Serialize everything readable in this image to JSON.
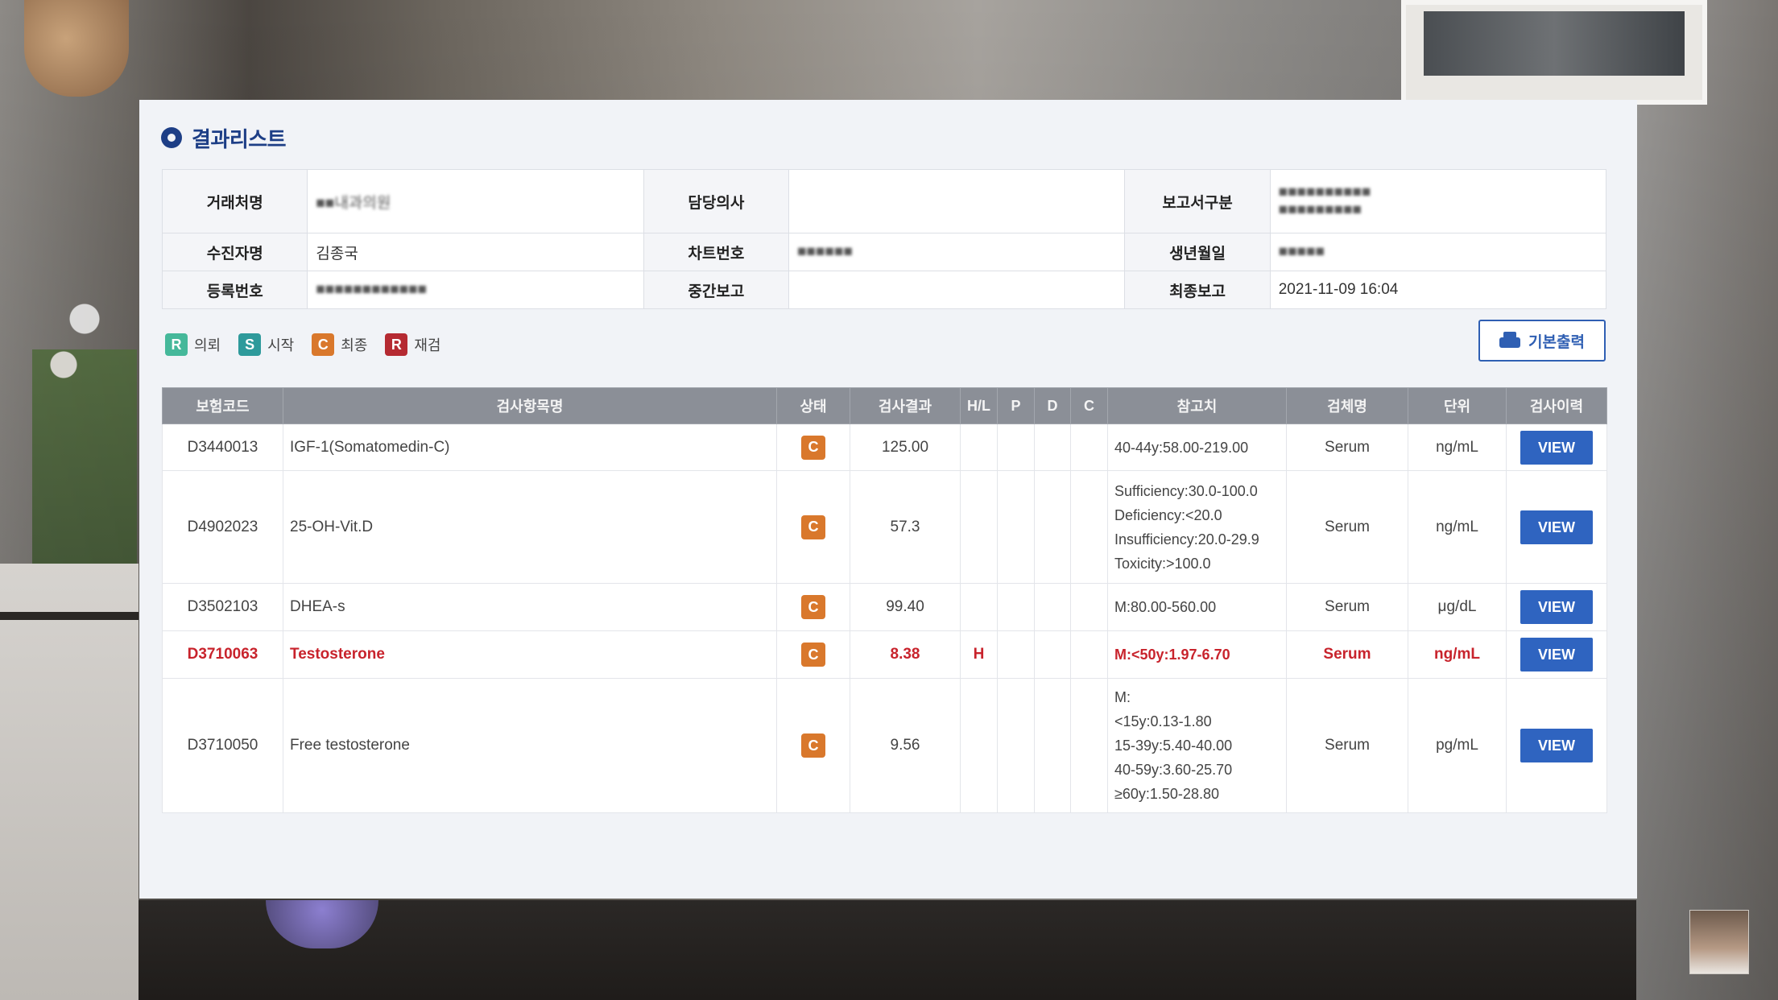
{
  "panel": {
    "title": "결과리스트"
  },
  "info": {
    "row1": {
      "client_label": "거래처명",
      "client_value": "■■내과의원",
      "doctor_label": "담당의사",
      "doctor_value": "",
      "report_type_label": "보고서구분",
      "report_type_value_1": "■■■■■■■■■■",
      "report_type_value_2": "■■■■■■■■■"
    },
    "row2": {
      "patient_label": "수진자명",
      "patient_value": "김종국",
      "chart_label": "차트번호",
      "chart_value": "■■■■■■",
      "birth_label": "생년월일",
      "birth_value": "■■■■■"
    },
    "row3": {
      "reg_label": "등록번호",
      "reg_value": "■■■■■■■■■■■■",
      "interim_label": "중간보고",
      "interim_value": "",
      "final_label": "최종보고",
      "final_value": "2021-11-09 16:04"
    }
  },
  "legend": [
    {
      "letter": "R",
      "label": "의뢰",
      "color": "#45b89a"
    },
    {
      "letter": "S",
      "label": "시작",
      "color": "#2e9a9b"
    },
    {
      "letter": "C",
      "label": "최종",
      "color": "#d9782c"
    },
    {
      "letter": "R",
      "label": "재검",
      "color": "#b52a32"
    }
  ],
  "print_button": {
    "label": "기본출력",
    "icon": "printer-icon"
  },
  "table": {
    "headers": [
      "보험코드",
      "검사항목명",
      "상태",
      "검사결과",
      "H/L",
      "P",
      "D",
      "C",
      "참고치",
      "검체명",
      "단위",
      "검사이력"
    ],
    "rows": [
      {
        "code": "D3440013",
        "name": "IGF-1(Somatomedin-C)",
        "status": "C",
        "result": "125.00",
        "hl": "",
        "p": "",
        "d": "",
        "c": "",
        "ref": [
          "40-44y:58.00-219.00"
        ],
        "specimen": "Serum",
        "unit": "ng/mL",
        "history": "VIEW",
        "highlight": false
      },
      {
        "code": "D4902023",
        "name": "25-OH-Vit.D",
        "status": "C",
        "result": "57.3",
        "hl": "",
        "p": "",
        "d": "",
        "c": "",
        "ref": [
          "Sufficiency:30.0-100.0",
          "Deficiency:<20.0",
          "Insufficiency:20.0-29.9",
          "Toxicity:>100.0"
        ],
        "specimen": "Serum",
        "unit": "ng/mL",
        "history": "VIEW",
        "highlight": false
      },
      {
        "code": "D3502103",
        "name": "DHEA-s",
        "status": "C",
        "result": "99.40",
        "hl": "",
        "p": "",
        "d": "",
        "c": "",
        "ref": [
          "M:80.00-560.00"
        ],
        "specimen": "Serum",
        "unit": "μg/dL",
        "history": "VIEW",
        "highlight": false
      },
      {
        "code": "D3710063",
        "name": "Testosterone",
        "status": "C",
        "result": "8.38",
        "hl": "H",
        "p": "",
        "d": "",
        "c": "",
        "ref": [
          "M:<50y:1.97-6.70"
        ],
        "specimen": "Serum",
        "unit": "ng/mL",
        "history": "VIEW",
        "highlight": true
      },
      {
        "code": "D3710050",
        "name": "Free testosterone",
        "status": "C",
        "result": "9.56",
        "hl": "",
        "p": "",
        "d": "",
        "c": "",
        "ref": [
          "M:",
          "<15y:0.13-1.80",
          "15-39y:5.40-40.00",
          "40-59y:3.60-25.70",
          "≥60y:1.50-28.80"
        ],
        "specimen": "Serum",
        "unit": "pg/mL",
        "history": "VIEW",
        "highlight": false
      }
    ]
  }
}
